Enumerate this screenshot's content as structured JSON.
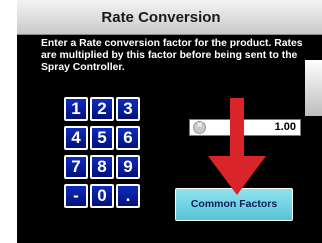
{
  "header": {
    "title": "Rate Conversion"
  },
  "instructions": {
    "line1": "Enter a Rate conversion factor for the product. Rates",
    "line2": "are multiplied by this factor before being sent to the",
    "line3": "Spray Controller."
  },
  "keypad": {
    "keys": [
      "1",
      "2",
      "3",
      "4",
      "5",
      "6",
      "7",
      "8",
      "9",
      "-",
      "0",
      "."
    ]
  },
  "factor_input": {
    "value": "1.00",
    "clear_icon": "clear-icon"
  },
  "buttons": {
    "common_factors": "Common Factors"
  },
  "annotation": {
    "arrow_color": "#d9252a",
    "arrow_icon": "arrow-down-icon"
  },
  "colors": {
    "key_blue": "#0a23a8",
    "button_cyan": "#6fd3e3",
    "panel_bg": "#000000"
  }
}
